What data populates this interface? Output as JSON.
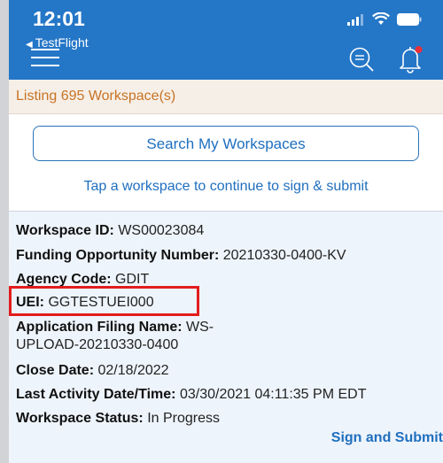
{
  "status_bar": {
    "time": "12:01",
    "back_app": "TestFlight"
  },
  "header": {
    "listing_text": "Listing 695 Workspace(s)"
  },
  "actions": {
    "search_label": "Search My Workspaces",
    "tap_hint": "Tap a workspace to continue to sign & submit",
    "sign_submit_label": "Sign and Submit"
  },
  "workspace": {
    "id_label": "Workspace ID:",
    "id_value": "WS00023084",
    "fon_label": "Funding Opportunity Number:",
    "fon_value": "20210330-0400-KV",
    "agency_label": "Agency Code:",
    "agency_value": "GDIT",
    "uei_label": "UEI:",
    "uei_value": "GGTESTUEI000",
    "filing_label": "Application Filing Name:",
    "filing_value_1": "WS-",
    "filing_value_2": "UPLOAD-20210330-0400",
    "close_label": "Close Date:",
    "close_value": "02/18/2022",
    "last_activity_label": "Last Activity Date/Time:",
    "last_activity_value": "03/30/2021 04:11:35 PM EDT",
    "status_label": "Workspace Status:",
    "status_value": "In Progress"
  },
  "colors": {
    "nav_blue": "#2476c7",
    "link_blue": "#1f6fbf",
    "orange_text": "#c87325",
    "highlight_red": "#e21d1d"
  },
  "icons": [
    "signal-icon",
    "wifi-icon",
    "battery-icon",
    "menu-icon",
    "search-icon",
    "bell-icon",
    "notification-dot"
  ]
}
